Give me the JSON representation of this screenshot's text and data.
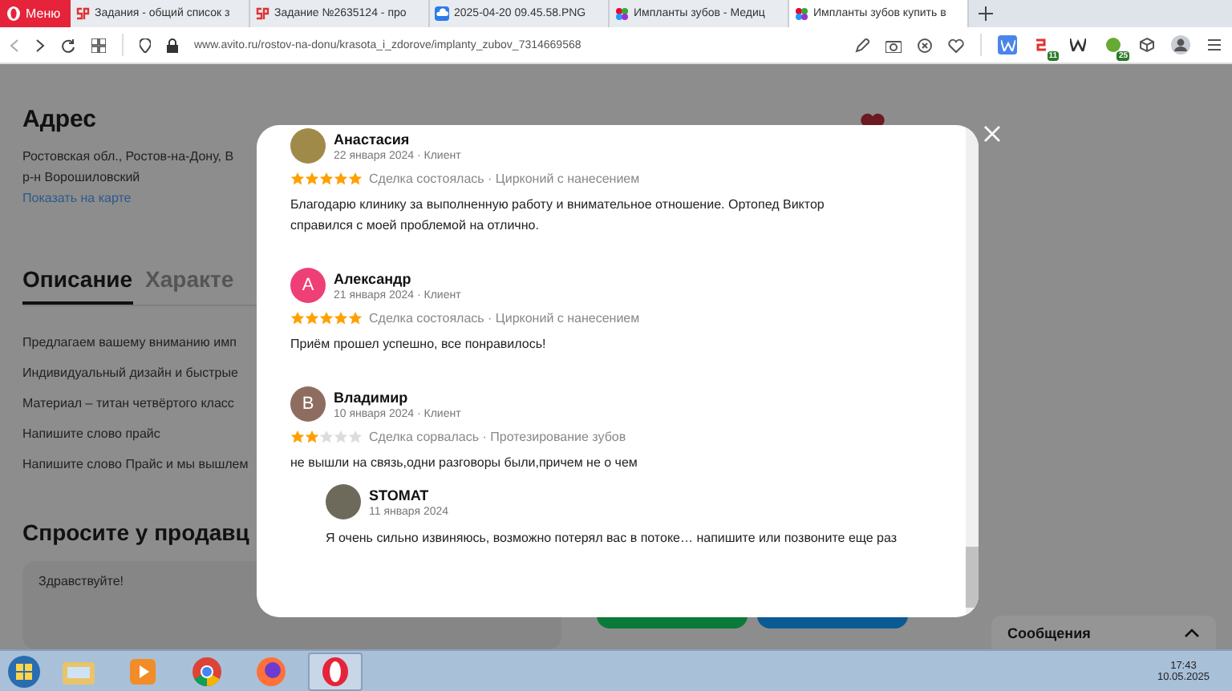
{
  "browser": {
    "menu_label": "Меню",
    "tabs": [
      {
        "title": "Задания - общий список з",
        "kind": "sp",
        "selected": false
      },
      {
        "title": "Задание №2635124 - про",
        "kind": "sp",
        "selected": false
      },
      {
        "title": "2025-04-20 09.45.58.PNG",
        "kind": "cloud",
        "selected": false
      },
      {
        "title": "Импланты зубов - Медиц",
        "kind": "flower",
        "selected": false
      },
      {
        "title": "Импланты зубов купить в",
        "kind": "flower",
        "selected": true
      }
    ],
    "url": "www.avito.ru/rostov-na-donu/krasota_i_zdorove/implanty_zubov_7314669568",
    "extensions": [
      {
        "kind": "w-blue"
      },
      {
        "kind": "sp",
        "badge": "11"
      },
      {
        "kind": "w"
      },
      {
        "kind": "globe",
        "badge": "25"
      },
      {
        "kind": "cube"
      },
      {
        "kind": "profile"
      },
      {
        "kind": "settings"
      }
    ]
  },
  "page": {
    "address": {
      "heading": "Адрес",
      "lines": [
        "Ростовская обл., Ростов-на-Дону, В",
        "р-н Ворошиловский"
      ],
      "map_link": "Показать на карте"
    },
    "tabs": [
      {
        "label": "Описание",
        "selected": true
      },
      {
        "label": "Характе",
        "selected": false
      }
    ],
    "description": [
      "Предлагаем вашему вниманию имп",
      "Индивидуальный дизайн и быстрые",
      "Материал – титан четвёртого класс",
      "Напишите слово прайс",
      "Напишите слово Прайс и мы вышлем"
    ],
    "ask": {
      "heading": "Спросите у продавц",
      "message": "Здравствуйте!"
    },
    "messages_panel": {
      "label": "Сообщения"
    }
  },
  "modal": {
    "reviews": [
      {
        "name": "Анастасия",
        "date": "22 января 2024 · Клиент",
        "avatar": {
          "kind": "photo"
        },
        "stars": 5,
        "meta": "Сделка состоялась · Цирконий с нанесением",
        "text": "Благодарю клинику за выполненную работу и внимательное отношение. Ортопед Виктор справился с моей проблемой на отлично."
      },
      {
        "name": "Александр",
        "date": "21 января 2024 · Клиент",
        "avatar": {
          "kind": "letter",
          "letter": "А",
          "color": "#ee3f76"
        },
        "stars": 5,
        "meta": "Сделка состоялась · Цирконий с нанесением",
        "text": "Приём прошел успешно, все понравилось!"
      },
      {
        "name": "Владимир",
        "date": "10 января 2024 · Клиент",
        "avatar": {
          "kind": "letter",
          "letter": "В",
          "color": "#8e6d60"
        },
        "stars": 2,
        "meta": "Сделка сорвалась · Протезирование зубов",
        "text": "не вышли на связь,одни разговоры были,причем не о чем",
        "reply": {
          "name": "STOMAT",
          "date": "11 января 2024",
          "text": "Я очень сильно извиняюсь, возможно потерял вас в потоке… напишите или позвоните еще раз"
        }
      }
    ]
  },
  "taskbar": {
    "apps": [
      {
        "kind": "folder",
        "selected": false
      },
      {
        "kind": "media",
        "selected": false
      },
      {
        "kind": "chrome",
        "selected": false
      },
      {
        "kind": "firefox",
        "selected": false
      },
      {
        "kind": "opera",
        "selected": true
      }
    ],
    "clock": {
      "time": "17:43",
      "date": "10.05.2025"
    }
  }
}
